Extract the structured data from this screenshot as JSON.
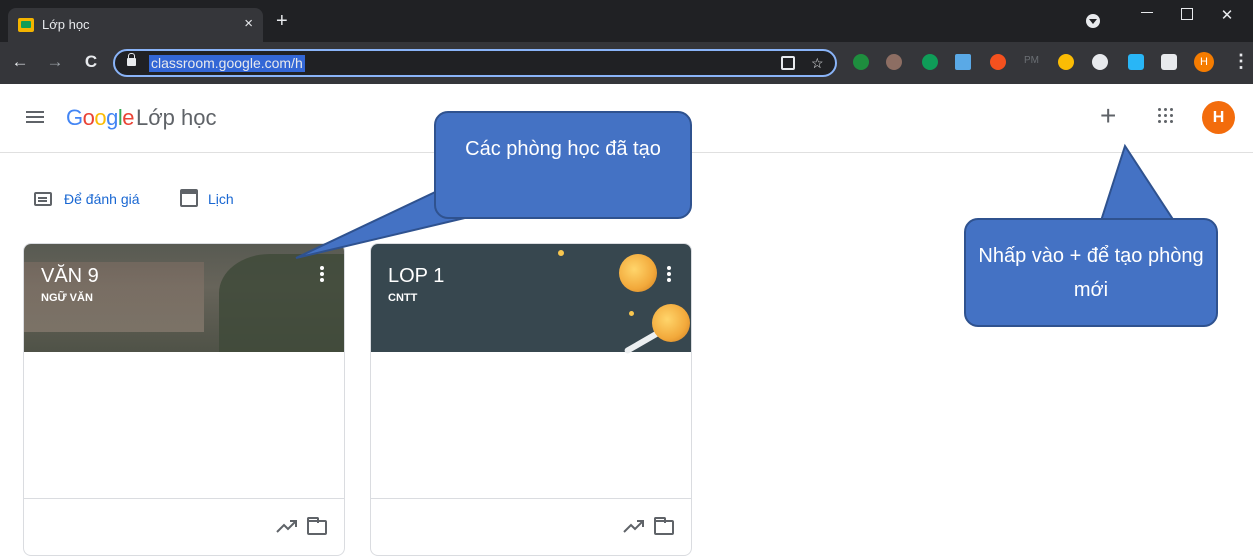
{
  "browser": {
    "tab_title": "Lớp học",
    "tab_close": "×",
    "new_tab": "+",
    "url": "classroom.google.com/h",
    "ext_pm": "PM",
    "profile_initial": "H",
    "menu": "⋮"
  },
  "header": {
    "logo_google": "Google",
    "logo_product": "Lớp học",
    "add_label": "+",
    "avatar_initial": "H"
  },
  "links": {
    "review_label": "Để đánh giá",
    "calendar_label": "Lịch"
  },
  "classes": [
    {
      "title": "VĂN 9",
      "subtitle": "NGỮ VĂN"
    },
    {
      "title": "LOP 1",
      "subtitle": "CNTT"
    }
  ],
  "callouts": {
    "created_classes": "Các phòng học đã tạo",
    "create_new": "Nhấp vào + để tạo phòng mới"
  },
  "colors": {
    "callout_fill": "#4472c4",
    "link_blue": "#1967d2",
    "avatar_orange": "#f36c0c",
    "banner_lop1": "#37474f"
  }
}
